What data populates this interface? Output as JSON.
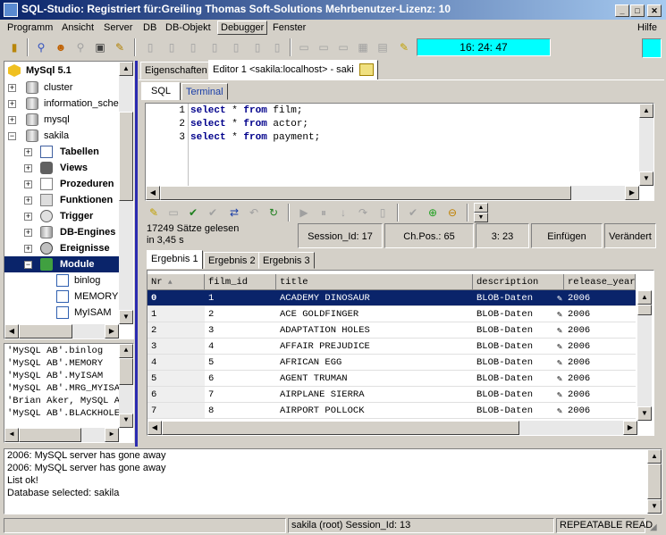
{
  "window": {
    "title": "SQL-Studio: Registriert für:Greiling Thomas Soft-Solutions Mehrbenutzer-Lizenz: 10"
  },
  "menubar": {
    "items": [
      "Programm",
      "Ansicht",
      "Server",
      "DB",
      "DB-Objekt",
      "Debugger",
      "Fenster"
    ],
    "help": "Hilfe"
  },
  "toolbar": {
    "clock": "16: 24: 47"
  },
  "tree": {
    "root": "MySql 5.1",
    "items": [
      "cluster",
      "information_schema",
      "mysql",
      "sakila",
      "Tabellen",
      "Views",
      "Prozeduren",
      "Funktionen",
      "Trigger",
      "DB-Engines",
      "Ereignisse",
      "Module",
      "binlog",
      "MEMORY",
      "MyISAM"
    ]
  },
  "code_list": [
    "'MySQL AB'.binlog",
    "'MySQL AB'.MEMORY",
    "'MySQL AB'.MyISAM",
    "'MySQL AB'.MRG_MYISAM",
    "'Brian Aker, MySQL AB'",
    "'MySQL AB'.BLACKHOLE"
  ],
  "top_tabs": {
    "properties": "Eigenschaften",
    "editor": "Editor  1 <sakila:localhost> - saki"
  },
  "sub_tabs": {
    "sql": "SQL",
    "terminal": "Terminal"
  },
  "sql_lines": [
    {
      "num": "1",
      "kw1": "select",
      "star": " * ",
      "kw2": "from",
      "rest": " film;"
    },
    {
      "num": "2",
      "kw1": "select",
      "star": " * ",
      "kw2": "from",
      "rest": " actor;"
    },
    {
      "num": "3",
      "kw1": "select",
      "star": " * ",
      "kw2": "from",
      "rest": " payment;"
    }
  ],
  "status": {
    "rows_read": "17249 Sätze gelesen",
    "time": "in 3,45 s",
    "session": "Session_Id: 17",
    "chpos": "Ch.Pos.:   65",
    "cursor": "3: 23",
    "mode": "Einfügen",
    "changed": "Verändert"
  },
  "result_tabs": [
    "Ergebnis 1",
    "Ergebnis 2",
    "Ergebnis 3"
  ],
  "grid": {
    "columns": [
      "Nr",
      "film_id",
      "title",
      "description",
      "release_year"
    ],
    "rows": [
      [
        "0",
        "1",
        "ACADEMY DINOSAUR",
        "BLOB-Daten",
        "2006"
      ],
      [
        "1",
        "2",
        "ACE GOLDFINGER",
        "BLOB-Daten",
        "2006"
      ],
      [
        "2",
        "3",
        "ADAPTATION HOLES",
        "BLOB-Daten",
        "2006"
      ],
      [
        "3",
        "4",
        "AFFAIR PREJUDICE",
        "BLOB-Daten",
        "2006"
      ],
      [
        "4",
        "5",
        "AFRICAN EGG",
        "BLOB-Daten",
        "2006"
      ],
      [
        "5",
        "6",
        "AGENT TRUMAN",
        "BLOB-Daten",
        "2006"
      ],
      [
        "6",
        "7",
        "AIRPLANE SIERRA",
        "BLOB-Daten",
        "2006"
      ],
      [
        "7",
        "8",
        "AIRPORT POLLOCK",
        "BLOB-Daten",
        "2006"
      ]
    ]
  },
  "log": [
    "2006: MySQL server has gone away",
    "2006: MySQL server has gone away",
    "List ok!",
    "Database selected: sakila"
  ],
  "statusbar": {
    "user": "sakila (root) Session_Id: 13",
    "isolation": "REPEATABLE READ"
  },
  "colors": {
    "selection": "#0a246a",
    "clock_bg": "#00ffff",
    "keyword": "#00008b"
  }
}
